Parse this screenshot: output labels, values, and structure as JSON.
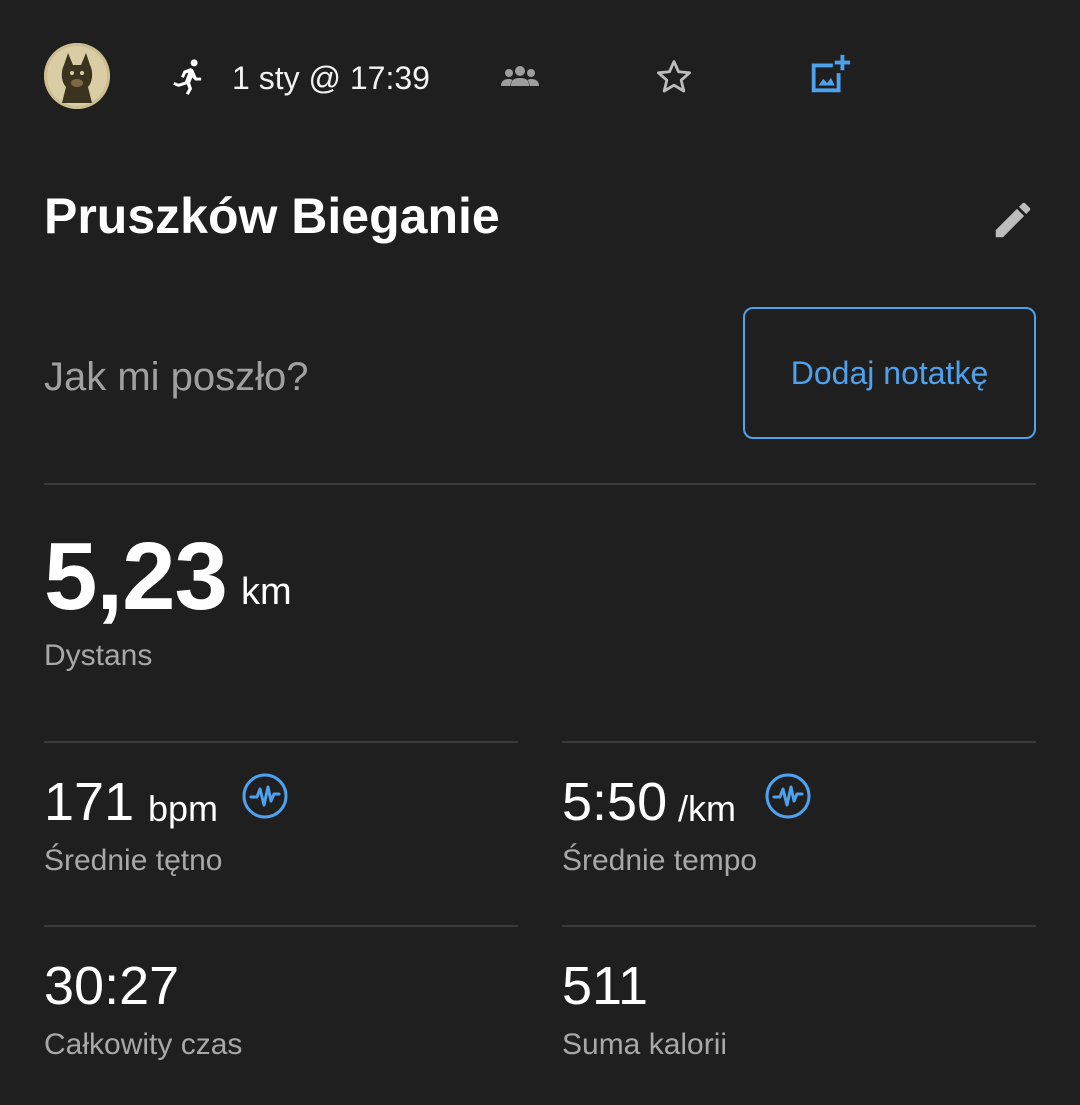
{
  "header": {
    "date_time": "1 sty @ 17:39",
    "icons": [
      "avatar",
      "running-icon",
      "group-icon",
      "star-icon",
      "add-photo-icon"
    ]
  },
  "activity": {
    "title": "Pruszków Bieganie"
  },
  "note": {
    "prompt": "Jak mi poszło?",
    "button_label": "Dodaj notatkę"
  },
  "distance": {
    "value": "5,23",
    "unit": "km",
    "label": "Dystans"
  },
  "stats": [
    {
      "value": "171",
      "unit": "bpm",
      "label": "Średnie tętno",
      "icon": "heart-rate-icon"
    },
    {
      "value": "5:50",
      "unit": "/km",
      "label": "Średnie tempo",
      "icon": "heart-rate-icon"
    },
    {
      "value": "30:27",
      "unit": "",
      "label": "Całkowity czas"
    },
    {
      "value": "511",
      "unit": "",
      "label": "Suma kalorii"
    }
  ],
  "colors": {
    "background": "#1f1f1f",
    "accent": "#4ea1ec",
    "divider": "#3a3a3a",
    "muted_text": "#a8a8a8"
  }
}
